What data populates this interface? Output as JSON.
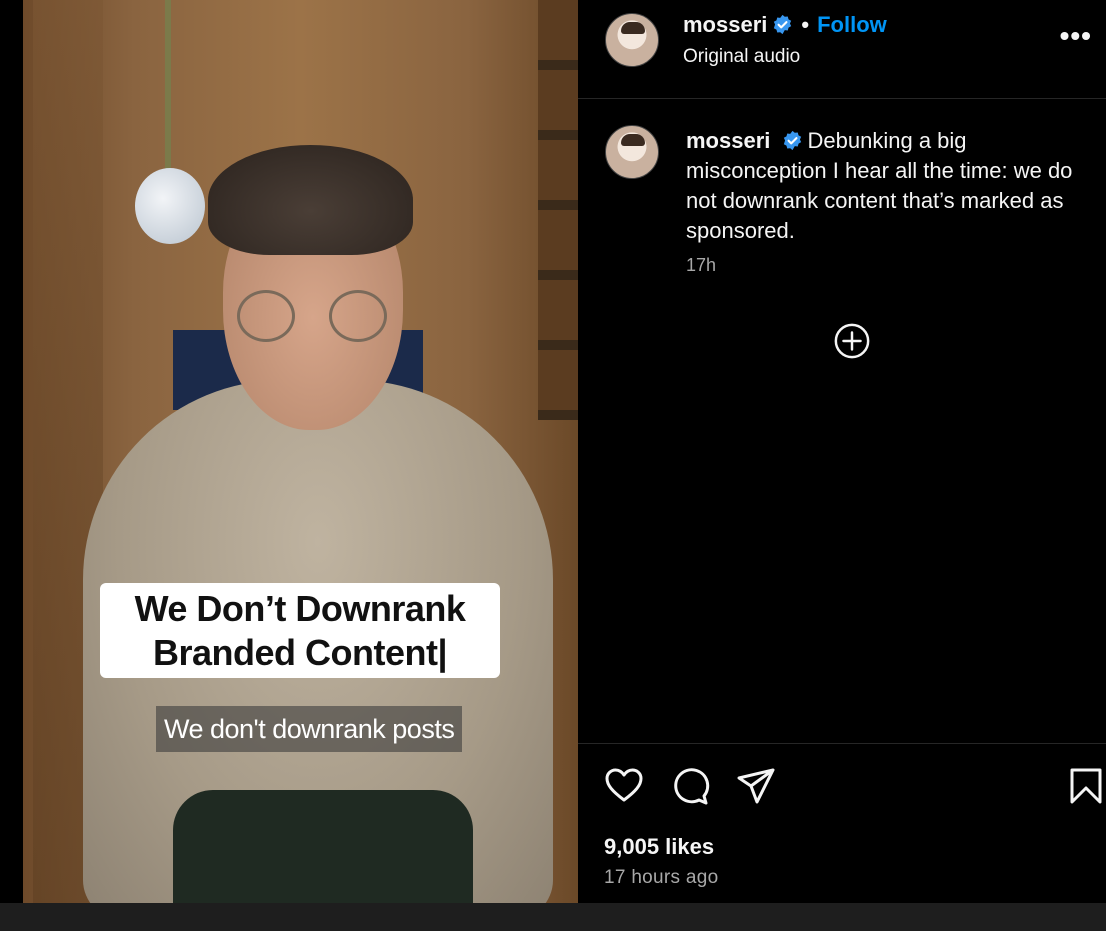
{
  "video": {
    "caption_line1": "We Don’t Downrank",
    "caption_line2": "Branded Content|",
    "subtitle": "We don't downrank posts"
  },
  "header": {
    "username": "mosseri",
    "separator": "•",
    "follow_label": "Follow",
    "audio_label": "Original audio",
    "more_label": "•••"
  },
  "post": {
    "username": "mosseri",
    "caption": "Debunking a big misconception I hear all the time: we do not downrank content that’s marked as sponsored.",
    "time": "17h"
  },
  "footer": {
    "likes": "9,005 likes",
    "posted_ago": "17 hours ago"
  },
  "colors": {
    "accent": "#0095f6",
    "verified": "#3897f0",
    "background": "#000000",
    "muted_text": "#a8a8a8"
  },
  "icons": [
    "verified-badge-icon",
    "more-options-icon",
    "add-comment-icon",
    "heart-icon",
    "comment-icon",
    "share-icon",
    "bookmark-icon"
  ]
}
